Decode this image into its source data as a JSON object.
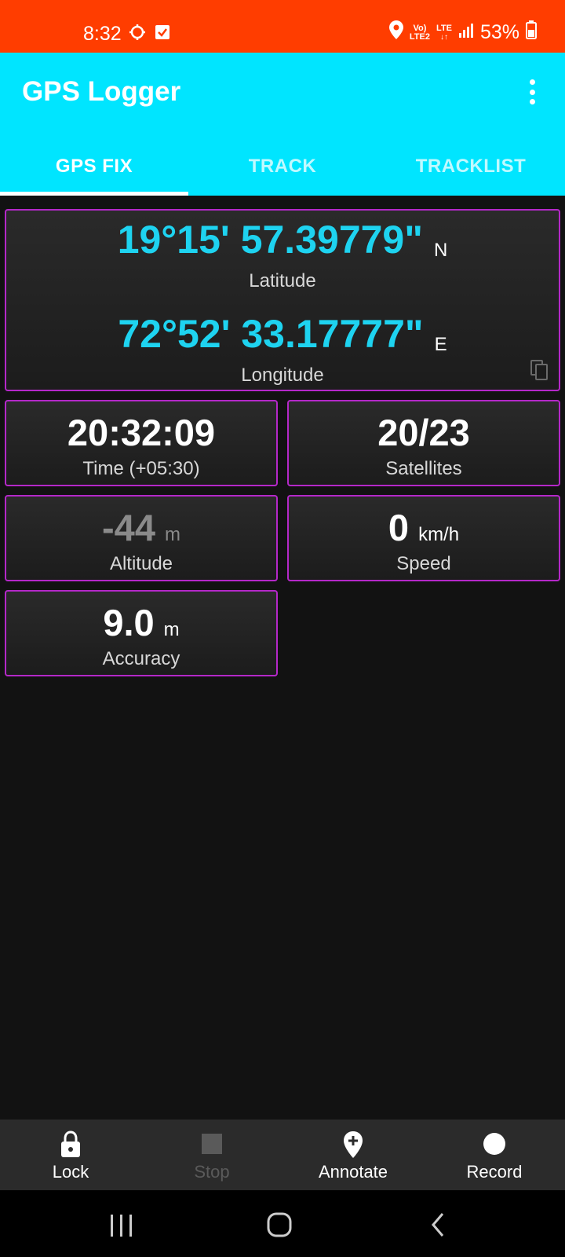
{
  "status_bar": {
    "time": "8:32",
    "network_top": "Vo)",
    "network_bottom": "LTE2",
    "lte": "LTE",
    "battery": "53%"
  },
  "app": {
    "title": "GPS Logger"
  },
  "tabs": [
    {
      "label": "GPS FIX",
      "active": true
    },
    {
      "label": "TRACK",
      "active": false
    },
    {
      "label": "TRACKLIST",
      "active": false
    }
  ],
  "coordinates": {
    "latitude_value": "19°15' 57.39779\"",
    "latitude_hemisphere": "N",
    "latitude_label": "Latitude",
    "longitude_value": "72°52' 33.17777\"",
    "longitude_hemisphere": "E",
    "longitude_label": "Longitude"
  },
  "stats": {
    "time_value": "20:32:09",
    "time_label": "Time (+05:30)",
    "satellites_value": "20/23",
    "satellites_label": "Satellites",
    "altitude_value": "-44",
    "altitude_unit": "m",
    "altitude_label": "Altitude",
    "speed_value": "0",
    "speed_unit": "km/h",
    "speed_label": "Speed",
    "accuracy_value": "9.0",
    "accuracy_unit": "m",
    "accuracy_label": "Accuracy"
  },
  "actions": {
    "lock": "Lock",
    "stop": "Stop",
    "annotate": "Annotate",
    "record": "Record"
  },
  "colors": {
    "status_bar": "#ff3d00",
    "app_bar": "#00e5ff",
    "coordinate_text": "#1ed3f0",
    "card_border": "#b428c8"
  }
}
